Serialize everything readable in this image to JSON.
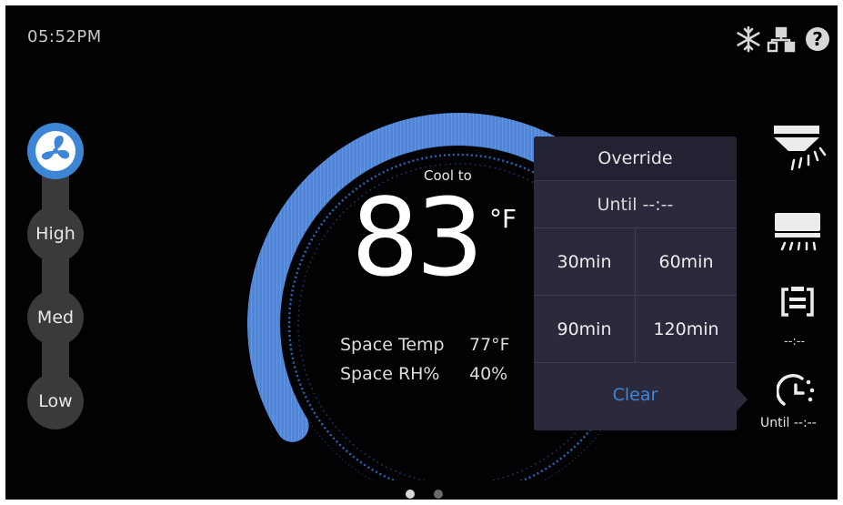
{
  "status": {
    "time": "05:52PM"
  },
  "top_icons": [
    "snowflake-icon",
    "network-icon",
    "help-icon"
  ],
  "fan": {
    "mode_icon": "fan-icon",
    "speeds": [
      {
        "label": "High"
      },
      {
        "label": "Med"
      },
      {
        "label": "Low"
      }
    ]
  },
  "setpoint": {
    "label": "Cool to",
    "value": "83",
    "unit": "°F",
    "level": 0.68
  },
  "space": {
    "temp_label": "Space Temp",
    "temp_value": "77°F",
    "rh_label": "Space RH%",
    "rh_value": "40%"
  },
  "override": {
    "title": "Override",
    "until": "Until --:--",
    "options": [
      "30min",
      "60min",
      "90min",
      "120min"
    ],
    "clear_label": "Clear"
  },
  "right_panel": {
    "icons": [
      "ac-swing-icon",
      "ac-vent-icon",
      "schedule-icon",
      "timer-icon"
    ],
    "schedule_value": "--:--",
    "timer_value": "Until --:--"
  },
  "pager": {
    "pages": 2,
    "current": 1
  },
  "colors": {
    "accent_blue": "#3d86d6",
    "panel_bg": "#2b2a3d",
    "clear_blue": "#3f86d8"
  }
}
